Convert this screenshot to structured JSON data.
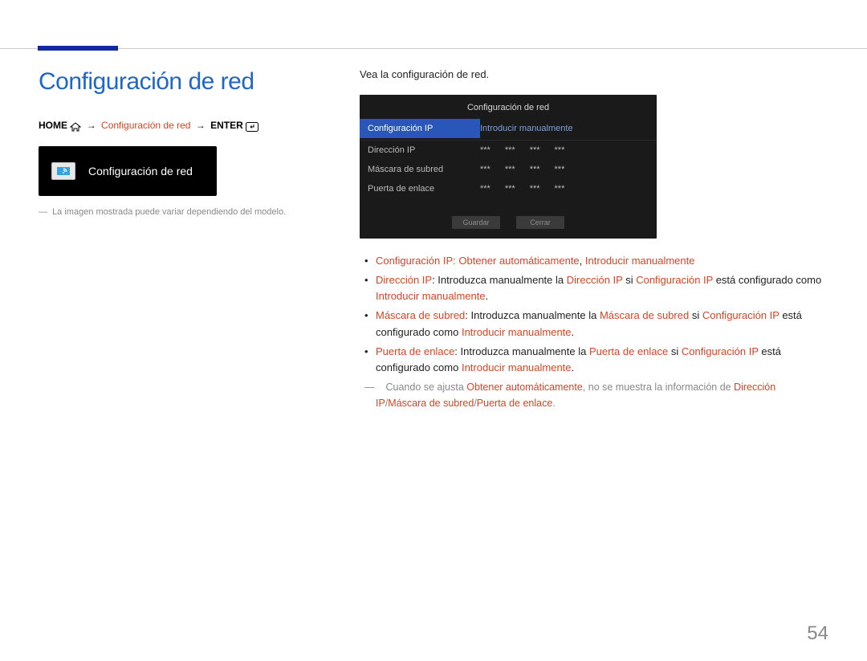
{
  "page": {
    "number": "54"
  },
  "title": "Configuración de red",
  "breadcrumb": {
    "home": "HOME",
    "step": "Configuración de red",
    "enter": "ENTER"
  },
  "widget": {
    "label": "Configuración de red"
  },
  "image_note": "La imagen mostrada puede variar dependiendo del modelo.",
  "intro": "Vea la configuración de red.",
  "tv": {
    "title": "Configuración de red",
    "rows": [
      {
        "label": "Configuración IP",
        "value": "Introducir manualmente",
        "selected": true
      },
      {
        "label": "Dirección IP",
        "octets": [
          "***",
          "***",
          "***",
          "***"
        ]
      },
      {
        "label": "Máscara de subred",
        "octets": [
          "***",
          "***",
          "***",
          "***"
        ]
      },
      {
        "label": "Puerta de enlace",
        "octets": [
          "***",
          "***",
          "***",
          "***"
        ]
      }
    ],
    "buttons": {
      "save": "Guardar",
      "close": "Cerrar"
    }
  },
  "bullets": {
    "b1": {
      "t1": "Configuración IP",
      "c1": ": ",
      "t2": "Obtener automáticamente",
      "c2": ", ",
      "t3": "Introducir manualmente"
    },
    "b2": {
      "t1": "Dirección IP",
      "c1": ": Introduzca manualmente la ",
      "t2": "Dirección IP",
      "c2": " si ",
      "t3": "Configuración IP",
      "c3": " está configurado como ",
      "t4": "Introducir manualmente",
      "c4": "."
    },
    "b3": {
      "t1": "Máscara de subred",
      "c1": ": Introduzca manualmente la ",
      "t2": "Máscara de subred",
      "c2": " si ",
      "t3": "Configuración IP",
      "c3": " está configurado como ",
      "t4": "Introducir manualmente",
      "c4": "."
    },
    "b4": {
      "t1": "Puerta de enlace",
      "c1": ": Introduzca manualmente la ",
      "t2": "Puerta de enlace",
      "c2": " si ",
      "t3": "Configuración IP",
      "c3": " está configurado como ",
      "t4": "Introducir manualmente",
      "c4": "."
    }
  },
  "note": {
    "c1": "Cuando se ajusta ",
    "t1": "Obtener automáticamente",
    "c2": ", no se muestra la información de ",
    "t2": "Dirección IP",
    "s1": "/",
    "t3": "Máscara de subred",
    "s2": "/",
    "t4": "Puerta de enlace",
    "c3": "."
  }
}
